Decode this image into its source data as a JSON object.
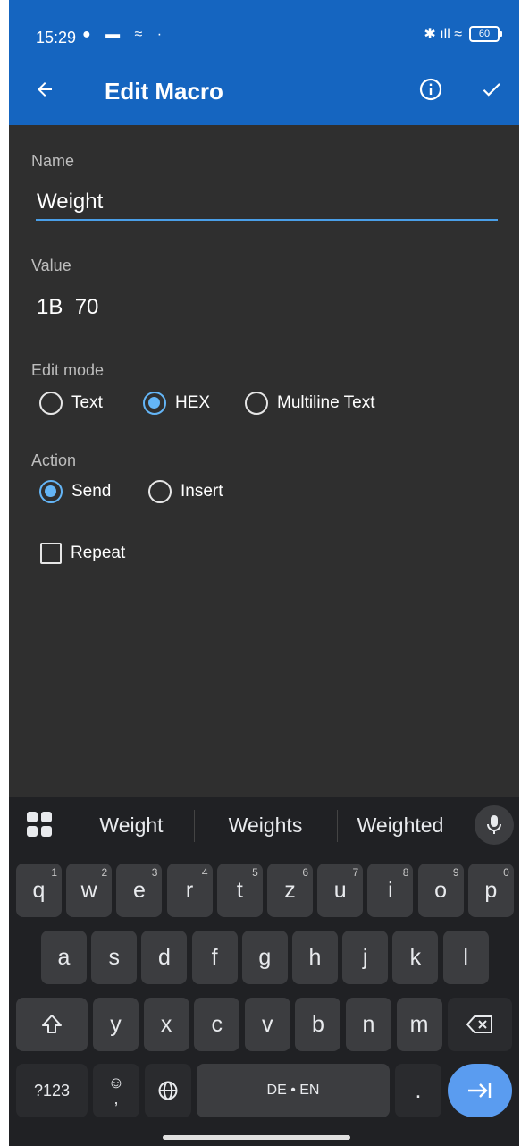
{
  "status": {
    "time": "15:29",
    "left_icons": "● ▬ ≈ ·",
    "right_icons": "✱ ıll ≈",
    "battery": "60"
  },
  "appbar": {
    "title": "Edit Macro"
  },
  "form": {
    "name": {
      "label": "Name",
      "value": "Weight"
    },
    "value": {
      "label": "Value",
      "value": "1B  70"
    },
    "edit_mode": {
      "label": "Edit mode",
      "options": [
        "Text",
        "HEX",
        "Multiline Text"
      ],
      "selected": "HEX"
    },
    "action": {
      "label": "Action",
      "options": [
        "Send",
        "Insert"
      ],
      "selected": "Send"
    },
    "repeat": {
      "label": "Repeat",
      "checked": false
    }
  },
  "keyboard": {
    "suggestions": [
      "Weight",
      "Weights",
      "Weighted"
    ],
    "row1": [
      {
        "k": "q",
        "h": "1"
      },
      {
        "k": "w",
        "h": "2"
      },
      {
        "k": "e",
        "h": "3"
      },
      {
        "k": "r",
        "h": "4"
      },
      {
        "k": "t",
        "h": "5"
      },
      {
        "k": "z",
        "h": "6"
      },
      {
        "k": "u",
        "h": "7"
      },
      {
        "k": "i",
        "h": "8"
      },
      {
        "k": "o",
        "h": "9"
      },
      {
        "k": "p",
        "h": "0"
      }
    ],
    "row2": [
      "a",
      "s",
      "d",
      "f",
      "g",
      "h",
      "j",
      "k",
      "l"
    ],
    "row3": [
      "y",
      "x",
      "c",
      "v",
      "b",
      "n",
      "m"
    ],
    "sym_key": "?123",
    "comma_key": ",",
    "space_label": "DE • EN",
    "period_key": "."
  },
  "colors": {
    "appbar": "#1565c0",
    "accent": "#64b5f6",
    "background": "#2f2f2f",
    "keyboard": "#202124"
  }
}
